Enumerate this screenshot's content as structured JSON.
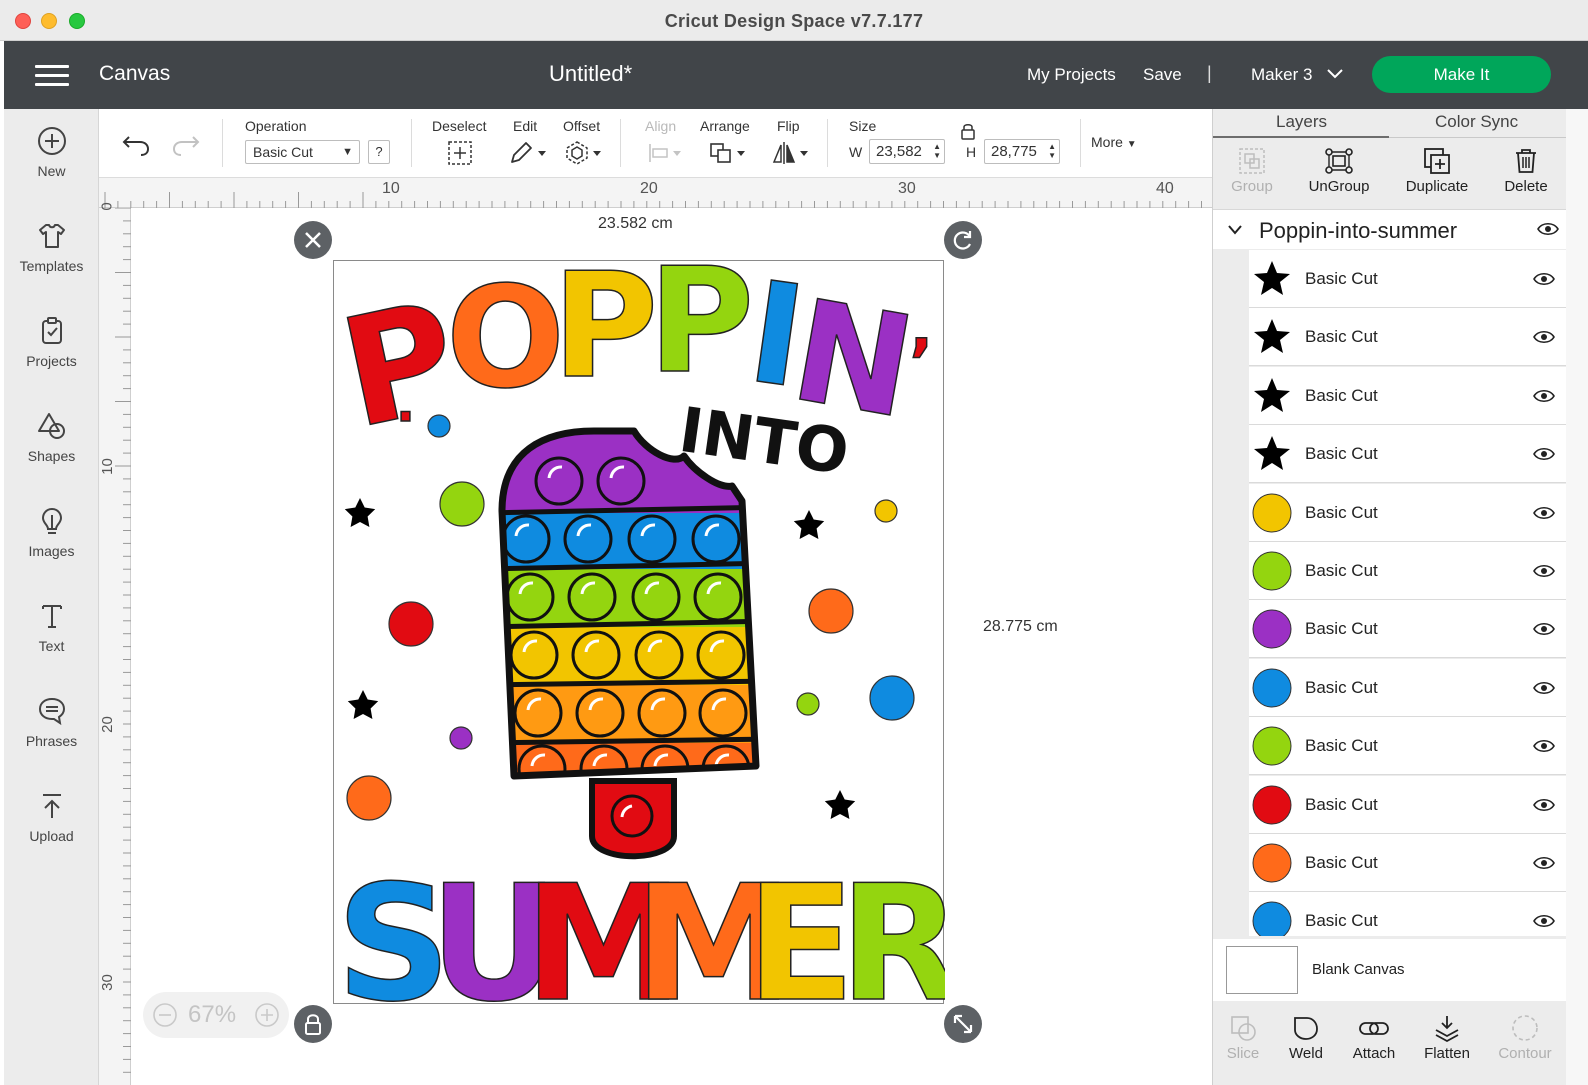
{
  "window": {
    "title": "Cricut Design Space  v7.7.177"
  },
  "header": {
    "section": "Canvas",
    "project_title": "Untitled*",
    "my_projects": "My Projects",
    "save": "Save",
    "separator": "|",
    "machine": "Maker 3",
    "make_it": "Make It",
    "make_it_color": "#00a65a"
  },
  "sidebar": {
    "items": [
      {
        "label": "New",
        "icon": "plus-circle-icon"
      },
      {
        "label": "Templates",
        "icon": "tshirt-icon"
      },
      {
        "label": "Projects",
        "icon": "projects-icon"
      },
      {
        "label": "Shapes",
        "icon": "shapes-icon"
      },
      {
        "label": "Images",
        "icon": "lightbulb-icon"
      },
      {
        "label": "Text",
        "icon": "text-icon"
      },
      {
        "label": "Phrases",
        "icon": "speech-bubble-icon"
      },
      {
        "label": "Upload",
        "icon": "upload-icon"
      }
    ]
  },
  "toolbar": {
    "operation_label": "Operation",
    "operation_value": "Basic Cut",
    "help": "?",
    "deselect": "Deselect",
    "edit": "Edit",
    "offset": "Offset",
    "align": "Align",
    "arrange": "Arrange",
    "flip": "Flip",
    "size_label": "Size",
    "w_label": "W",
    "h_label": "H",
    "width": "23,582",
    "height": "28,775",
    "more": "More"
  },
  "rulers": {
    "top": [
      "10",
      "20",
      "30",
      "40"
    ],
    "left": [
      "0",
      "10",
      "20",
      "30"
    ]
  },
  "canvas": {
    "width_dim": "23.582 cm",
    "height_dim": "28.775 cm",
    "zoom": "67%",
    "design_text_top": "POPPIN'",
    "design_text_mid": "INTO",
    "design_text_bottom": "SUMMER"
  },
  "right_panel": {
    "tabs": [
      "Layers",
      "Color Sync"
    ],
    "tools": [
      "Group",
      "UnGroup",
      "Duplicate",
      "Delete"
    ],
    "group_name": "Poppin-into-summer",
    "layers": [
      {
        "label": "Basic Cut",
        "shape": "star",
        "color": "#000000"
      },
      {
        "label": "Basic Cut",
        "shape": "star",
        "color": "#000000"
      },
      {
        "label": "Basic Cut",
        "shape": "star",
        "color": "#000000"
      },
      {
        "label": "Basic Cut",
        "shape": "star",
        "color": "#000000"
      },
      {
        "label": "Basic Cut",
        "shape": "circle",
        "color": "#f2c500"
      },
      {
        "label": "Basic Cut",
        "shape": "circle",
        "color": "#94d50f"
      },
      {
        "label": "Basic Cut",
        "shape": "circle",
        "color": "#9b30c4"
      },
      {
        "label": "Basic Cut",
        "shape": "circle",
        "color": "#0f8be0"
      },
      {
        "label": "Basic Cut",
        "shape": "circle",
        "color": "#94d50f"
      },
      {
        "label": "Basic Cut",
        "shape": "circle",
        "color": "#e10b12"
      },
      {
        "label": "Basic Cut",
        "shape": "circle",
        "color": "#ff6a1a"
      },
      {
        "label": "Basic Cut",
        "shape": "circle",
        "color": "#0f8be0"
      }
    ],
    "blank_canvas": "Blank Canvas",
    "bottom_tools": [
      "Slice",
      "Weld",
      "Attach",
      "Flatten",
      "Contour"
    ]
  }
}
